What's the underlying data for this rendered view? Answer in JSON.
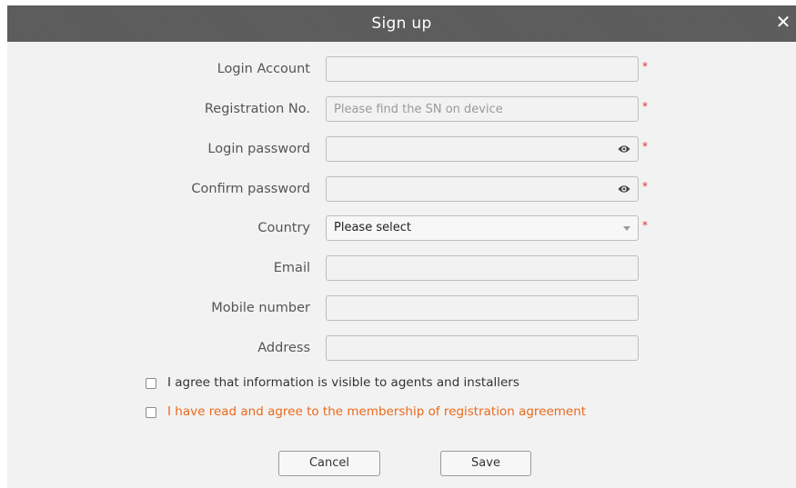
{
  "dialog": {
    "title": "Sign up",
    "close_symbol": "✕"
  },
  "form": {
    "login_account": {
      "label": "Login Account",
      "value": "",
      "placeholder": "",
      "required": "*"
    },
    "registration_no": {
      "label": "Registration No.",
      "value": "",
      "placeholder": "Please find the SN on device",
      "required": "*"
    },
    "login_password": {
      "label": "Login password",
      "value": "",
      "placeholder": "",
      "required": "*",
      "icon": "eye-icon"
    },
    "confirm_password": {
      "label": "Confirm password",
      "value": "",
      "placeholder": "",
      "required": "*",
      "icon": "eye-icon"
    },
    "country": {
      "label": "Country",
      "selected": "Please select",
      "required": "*",
      "icon": "chevron-down-icon"
    },
    "email": {
      "label": "Email",
      "value": "",
      "placeholder": ""
    },
    "mobile": {
      "label": "Mobile number",
      "value": "",
      "placeholder": ""
    },
    "address": {
      "label": "Address",
      "value": "",
      "placeholder": ""
    }
  },
  "agreements": {
    "visible_to_agents": {
      "label": "I agree that information is visible to agents and installers",
      "checked": false
    },
    "membership": {
      "label": "I have read and agree to the membership of registration agreement",
      "checked": false,
      "color": "#ea6a1b"
    }
  },
  "buttons": {
    "cancel": "Cancel",
    "save": "Save"
  },
  "colors": {
    "titlebar": "#5b5b5b",
    "dialog_bg": "#f2f2f2",
    "required": "#e03030",
    "link_orange": "#ea6a1b"
  }
}
